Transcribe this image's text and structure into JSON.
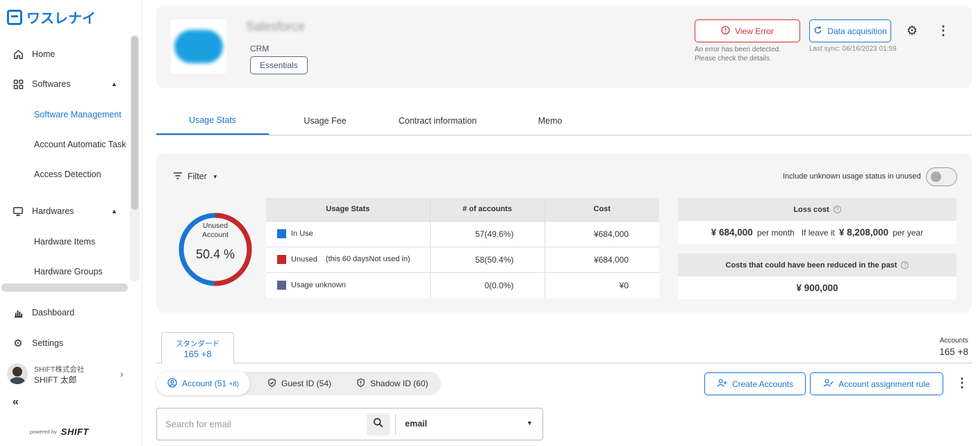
{
  "brand": {
    "logo_text": "ワスレナイ",
    "powered_by": "powered by",
    "powered_brand": "SHIFT"
  },
  "sidebar": {
    "items": [
      {
        "label": "Home",
        "icon": "home-icon"
      },
      {
        "label": "Softwares",
        "icon": "grid-icon"
      },
      {
        "label": "Software Management"
      },
      {
        "label": "Account Automatic Task"
      },
      {
        "label": "Access Detection"
      },
      {
        "label": "Hardwares",
        "icon": "monitor-icon"
      },
      {
        "label": "Hardware Items"
      },
      {
        "label": "Hardware Groups"
      },
      {
        "label": "Dashboard",
        "icon": "bar-chart-icon"
      },
      {
        "label": "Settings",
        "icon": "gear-icon"
      }
    ],
    "user": {
      "company": "SHIFT株式会社",
      "name": "SHIFT 太郎"
    }
  },
  "app": {
    "name": "Salesforce",
    "category": "CRM",
    "plan": "Essentials",
    "view_error": "View Error",
    "error_message_1": "An error has been detected.",
    "error_message_2": "Please check the details.",
    "data_acquisition": "Data acquisition",
    "last_sync": "Last sync: 06/16/2023 01:59"
  },
  "tabs": [
    "Usage Stats",
    "Usage Fee",
    "Contract information",
    "Memo"
  ],
  "stats": {
    "filter": "Filter",
    "toggle_label": "Include unknown usage status in unused",
    "donut_label_1": "Unused",
    "donut_label_2": "Account",
    "donut_value": "50.4 %",
    "unused_fraction": 0.504,
    "table_headers": [
      "Usage Stats",
      "# of accounts",
      "Cost"
    ],
    "rows": [
      {
        "name": "In Use",
        "note": "",
        "accounts": "57(49.6%)",
        "cost": "¥684,000",
        "color": "#1976d2"
      },
      {
        "name": "Unused",
        "note": "(this 60 daysNot used in)",
        "accounts": "58(50.4%)",
        "cost": "¥684,000",
        "color": "#c62828"
      },
      {
        "name": "Usage unknown",
        "note": "",
        "accounts": "0(0.0%)",
        "cost": "¥0",
        "color": "#5c6290"
      }
    ],
    "loss_title": "Loss cost",
    "loss_month": "¥ 684,000",
    "per_month": "per month",
    "if_leave": "If leave it",
    "loss_year": "¥ 8,208,000",
    "per_year": "per year",
    "past_title": "Costs that could have been reduced in the past",
    "past_value": "¥ 900,000"
  },
  "plan_tab": {
    "label": "スタンダード",
    "count": "165 +8"
  },
  "accounts_total": {
    "label": "Accounts",
    "value": "165 +8"
  },
  "id_tabs": [
    {
      "label": "Account (51 ",
      "extra": "+8)"
    },
    {
      "label": "Guest ID (54)"
    },
    {
      "label": "Shadow ID (60)"
    }
  ],
  "actions": {
    "create": "Create Accounts",
    "rule": "Account assignment rule"
  },
  "search": {
    "placeholder": "Search for email",
    "field": "email"
  },
  "colors": {
    "accent": "#1976d2",
    "error": "#d32f2f"
  }
}
